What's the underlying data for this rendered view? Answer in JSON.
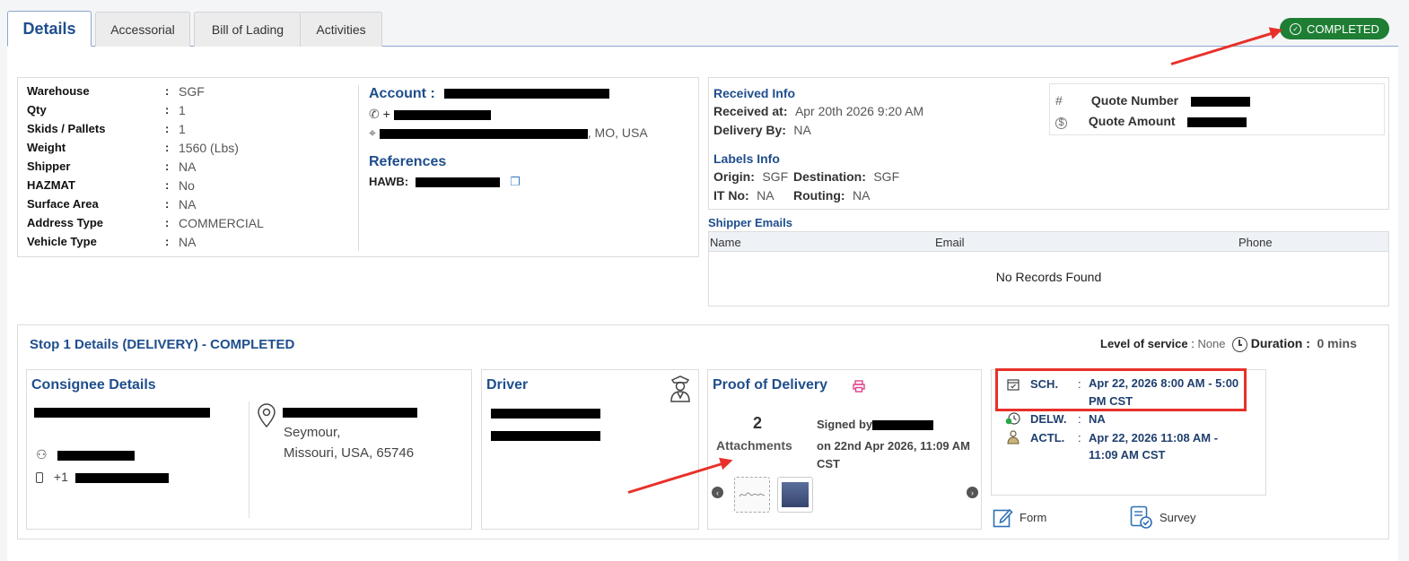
{
  "tabs": [
    "Details",
    "Accessorial",
    "Bill of Lading",
    "Activities"
  ],
  "status": "COMPLETED",
  "shipment": {
    "rows": [
      {
        "label": "Warehouse",
        "value": "SGF"
      },
      {
        "label": "Qty",
        "value": "1"
      },
      {
        "label": "Skids / Pallets",
        "value": "1"
      },
      {
        "label": "Weight",
        "value": "1560 (Lbs)"
      },
      {
        "label": "Shipper",
        "value": "NA"
      },
      {
        "label": "HAZMAT",
        "value": "No"
      },
      {
        "label": "Surface Area",
        "value": "NA"
      },
      {
        "label": "Address Type",
        "value": "COMMERCIAL"
      },
      {
        "label": "Vehicle Type",
        "value": "NA"
      }
    ],
    "colon": ":"
  },
  "account": {
    "title": "Account :",
    "phone_prefix": "+",
    "address_suffix": ", MO, USA",
    "references_title": "References",
    "hawb_label": "HAWB:"
  },
  "received": {
    "title": "Received Info",
    "received_at_label": "Received at:",
    "received_at_value": "Apr 20th 2026 9:20 AM",
    "delivery_by_label": "Delivery By:",
    "delivery_by_value": "NA",
    "labels_title": "Labels Info",
    "origin_label": "Origin:",
    "origin_value": "SGF",
    "destination_label": "Destination:",
    "destination_value": "SGF",
    "itno_label": "IT No:",
    "itno_value": "NA",
    "routing_label": "Routing:",
    "routing_value": "NA",
    "quote_number_label": "Quote Number",
    "quote_amount_label": "Quote Amount"
  },
  "shipper_emails": {
    "title": "Shipper Emails",
    "columns": [
      "Name",
      "Email",
      "Phone"
    ],
    "empty": "No Records Found"
  },
  "stop": {
    "title": "Stop 1 Details (DELIVERY) - COMPLETED",
    "level_label": "Level of service",
    "level_colon": ":",
    "level_value": "None",
    "duration_label": "Duration :",
    "duration_value": "0 mins"
  },
  "consignee": {
    "title": "Consignee Details",
    "city": "Seymour,",
    "state_line": "Missouri, USA, 65746",
    "phone_prefix": "+1"
  },
  "driver": {
    "title": "Driver"
  },
  "pod": {
    "title": "Proof of Delivery",
    "count": "2",
    "attachments_label": "Attachments",
    "signed_by": "Signed by",
    "signed_on": "on 22nd Apr 2026, 11:09 AM CST"
  },
  "schedule": {
    "sch_label": "SCH.",
    "sch_value": "Apr 22, 2026 8:00 AM - 5:00 PM CST",
    "delw_label": "DELW.",
    "delw_value": "NA",
    "actl_label": "ACTL.",
    "actl_value": "Apr 22, 2026 11:08 AM - 11:09 AM CST",
    "colon": ":"
  },
  "actions": {
    "form": "Form",
    "survey": "Survey"
  },
  "colors": {
    "accent": "#1f4e8c",
    "success": "#1e7e34",
    "annotation": "#e8302a"
  }
}
